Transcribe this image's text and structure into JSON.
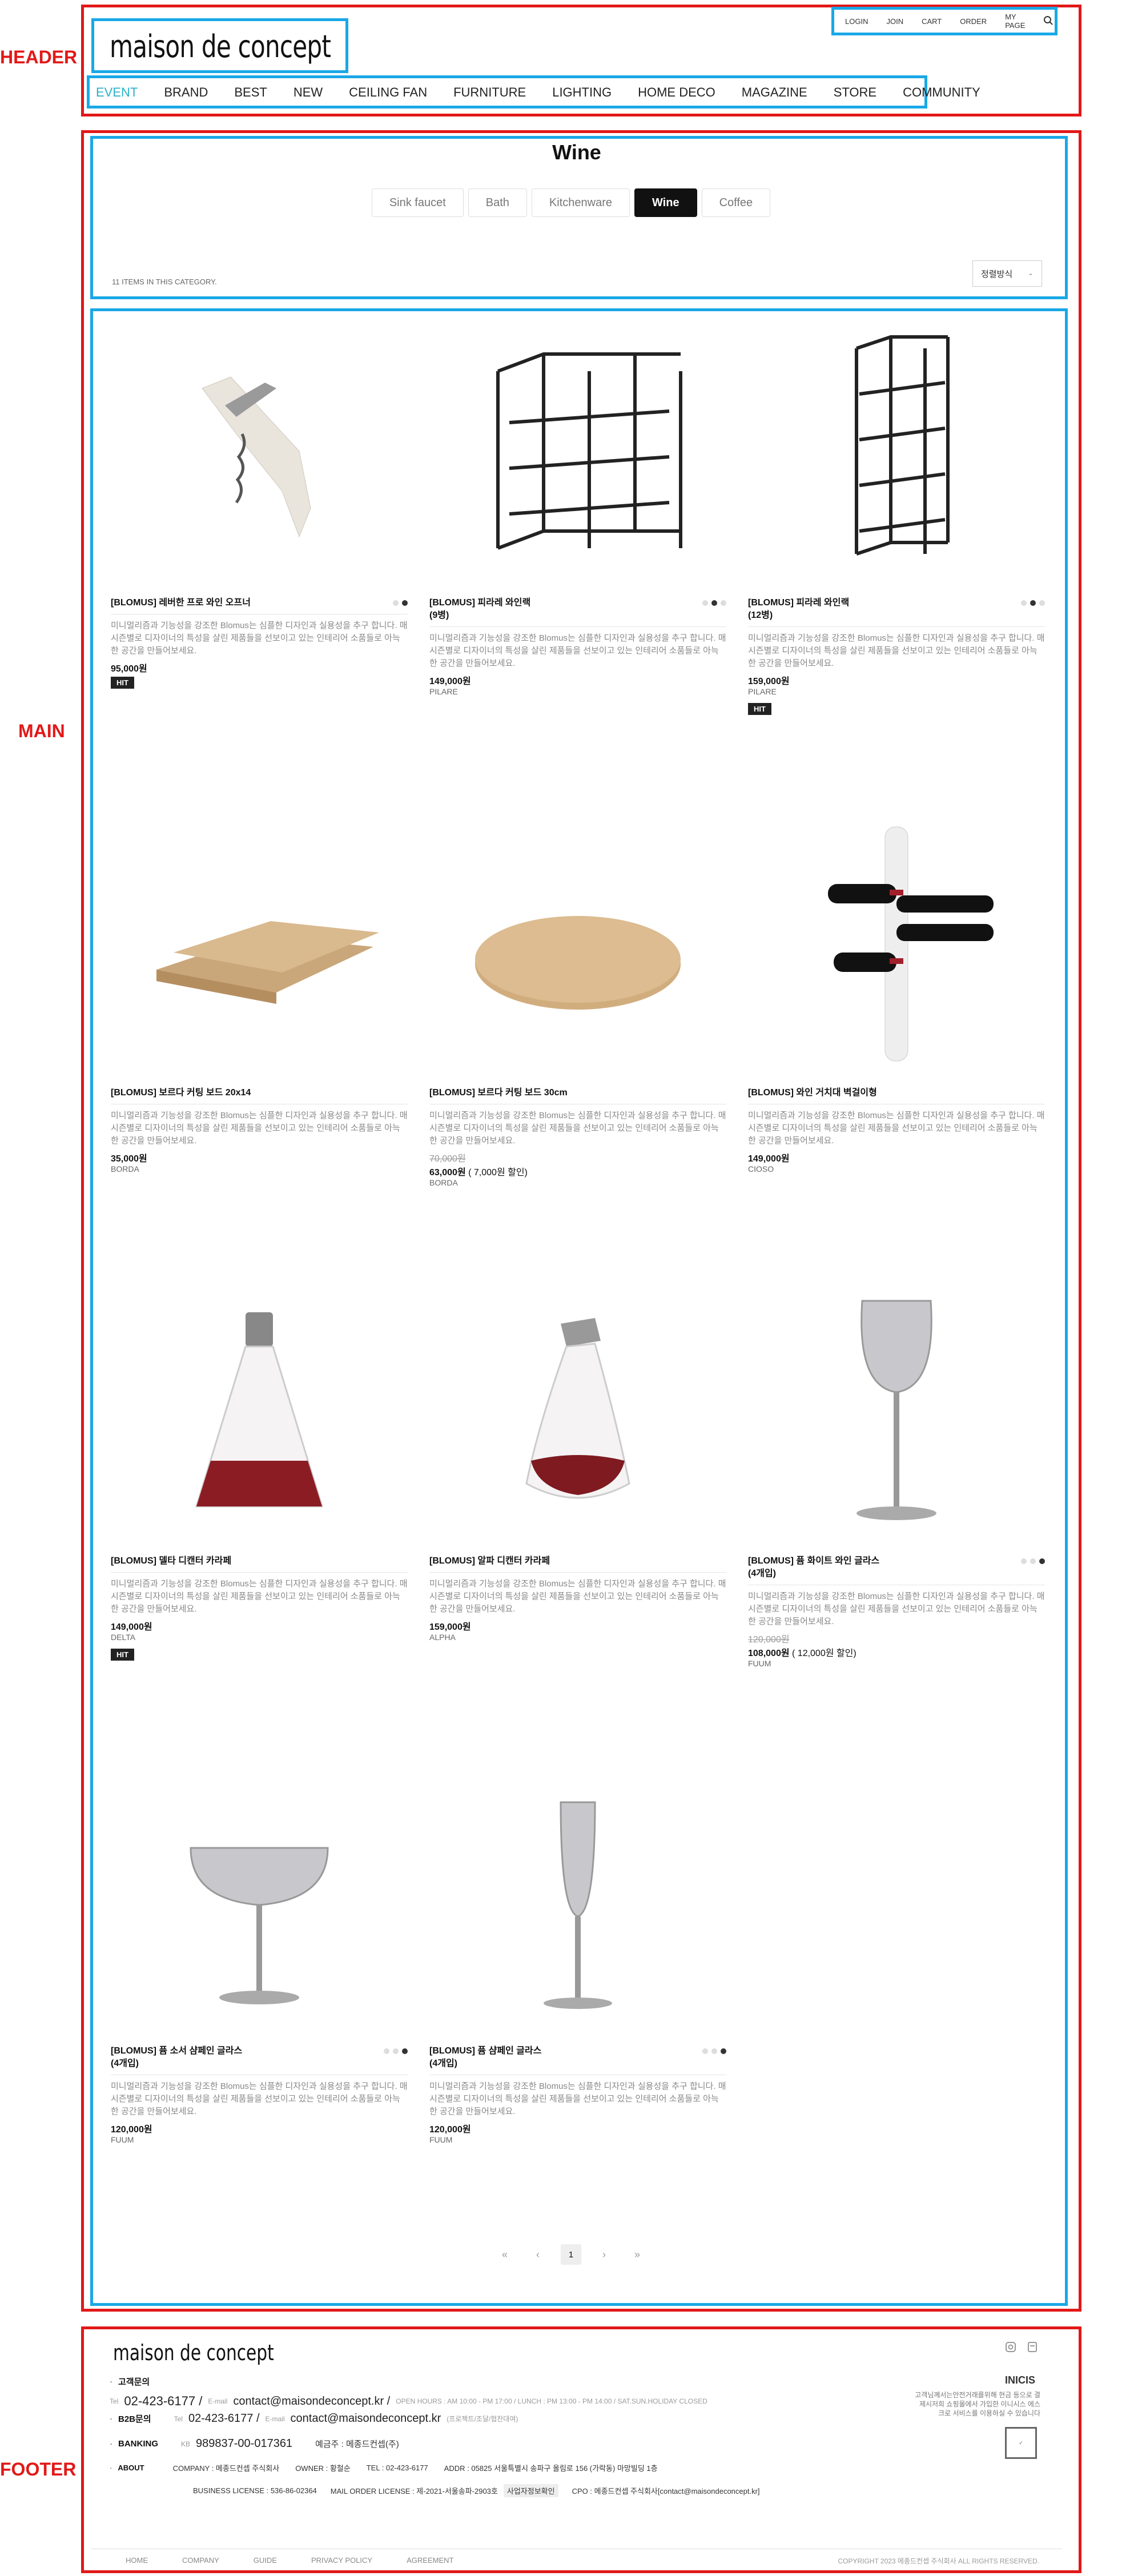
{
  "annotations": {
    "header": "HEADER",
    "main": "MAIN",
    "footer": "FOOTER"
  },
  "header": {
    "logo": "maison de concept",
    "utility": [
      "LOGIN",
      "JOIN",
      "CART",
      "ORDER",
      "MY PAGE"
    ],
    "search_icon": "search-icon",
    "nav": [
      "EVENT",
      "BRAND",
      "BEST",
      "NEW",
      "CEILING FAN",
      "FURNITURE",
      "LIGHTING",
      "HOME DECO",
      "MAGAZINE",
      "STORE",
      "COMMUNITY"
    ],
    "active_color": "#2bb0c8"
  },
  "category": {
    "title": "Wine",
    "tabs": [
      {
        "label": "Sink faucet",
        "active": false
      },
      {
        "label": "Bath",
        "active": false
      },
      {
        "label": "Kitchenware",
        "active": false
      },
      {
        "label": "Wine",
        "active": true
      },
      {
        "label": "Coffee",
        "active": false
      }
    ],
    "item_count": "11 ITEMS IN THIS CATEGORY.",
    "sort_label": "정렬방식"
  },
  "products": [
    {
      "name": "[BLOMUS] 레버한 프로 와인 오프너",
      "desc": "미니멀리즘과 기능성을 강조한 Blomus는 심플한 디자인과 실용성을 추구 합니다. 매 시즌별로 디자이너의 특성을 살린 제품들을 선보이고 있는 인테리어 소품들로 아늑한 공간을 만들어보세요.",
      "price": "95,000원",
      "old_price": "",
      "sale": "",
      "brand": "",
      "hit": "HIT",
      "dots": 2,
      "dot_on": 1
    },
    {
      "name": "[BLOMUS] 피라레 와인랙\n(9병)",
      "desc": "미니멀리즘과 기능성을 강조한 Blomus는 심플한 디자인과 실용성을 추구 합니다. 매 시즌별로 디자이너의 특성을 살린 제품들을 선보이고 있는 인테리어 소품들로 아늑한 공간을 만들어보세요.",
      "price": "149,000원",
      "old_price": "",
      "sale": "",
      "brand": "PILARE",
      "hit": "",
      "dots": 3,
      "dot_on": 1
    },
    {
      "name": "[BLOMUS] 피라레 와인랙\n(12병)",
      "desc": "미니멀리즘과 기능성을 강조한 Blomus는 심플한 디자인과 실용성을 추구 합니다. 매 시즌별로 디자이너의 특성을 살린 제품들을 선보이고 있는 인테리어 소품들로 아늑한 공간을 만들어보세요.",
      "price": "159,000원",
      "old_price": "",
      "sale": "",
      "brand": "PILARE",
      "hit": "HIT",
      "dots": 3,
      "dot_on": 1
    },
    {
      "name": "[BLOMUS] 보르다 커팅 보드 20x14",
      "desc": "미니멀리즘과 기능성을 강조한 Blomus는 심플한 디자인과 실용성을 추구 합니다. 매 시즌별로 디자이너의 특성을 살린 제품들을 선보이고 있는 인테리어 소품들로 아늑한 공간을 만들어보세요.",
      "price": "35,000원",
      "old_price": "",
      "sale": "",
      "brand": "BORDA",
      "hit": "",
      "dots": 0,
      "dot_on": -1
    },
    {
      "name": "[BLOMUS] 보르다 커팅 보드 30cm",
      "desc": "미니멀리즘과 기능성을 강조한 Blomus는 심플한 디자인과 실용성을 추구 합니다. 매 시즌별로 디자이너의 특성을 살린 제품들을 선보이고 있는 인테리어 소품들로 아늑한 공간을 만들어보세요.",
      "price": "63,000원",
      "old_price": "70,000원",
      "sale": "( 7,000원 할인)",
      "brand": "BORDA",
      "hit": "",
      "dots": 0,
      "dot_on": -1
    },
    {
      "name": "[BLOMUS] 와인 거치대 벽걸이형",
      "desc": "미니멀리즘과 기능성을 강조한 Blomus는 심플한 디자인과 실용성을 추구 합니다. 매 시즌별로 디자이너의 특성을 살린 제품들을 선보이고 있는 인테리어 소품들로 아늑한 공간을 만들어보세요.",
      "price": "149,000원",
      "old_price": "",
      "sale": "",
      "brand": "CIOSO",
      "hit": "",
      "dots": 0,
      "dot_on": -1
    },
    {
      "name": "[BLOMUS] 델타 디캔터 카라페",
      "desc": "미니멀리즘과 기능성을 강조한 Blomus는 심플한 디자인과 실용성을 추구 합니다. 매 시즌별로 디자이너의 특성을 살린 제품들을 선보이고 있는 인테리어 소품들로 아늑한 공간을 만들어보세요.",
      "price": "149,000원",
      "old_price": "",
      "sale": "",
      "brand": "DELTA",
      "hit": "HIT",
      "dots": 0,
      "dot_on": -1
    },
    {
      "name": "[BLOMUS] 알파 디캔터 카라페",
      "desc": "미니멀리즘과 기능성을 강조한 Blomus는 심플한 디자인과 실용성을 추구 합니다. 매 시즌별로 디자이너의 특성을 살린 제품들을 선보이고 있는 인테리어 소품들로 아늑한 공간을 만들어보세요.",
      "price": "159,000원",
      "old_price": "",
      "sale": "",
      "brand": "ALPHA",
      "hit": "",
      "dots": 0,
      "dot_on": -1
    },
    {
      "name": "[BLOMUS] 퓸 화이트 와인 글라스\n(4개입)",
      "desc": "미니멀리즘과 기능성을 강조한 Blomus는 심플한 디자인과 실용성을 추구 합니다. 매 시즌별로 디자이너의 특성을 살린 제품들을 선보이고 있는 인테리어 소품들로 아늑한 공간을 만들어보세요.",
      "price": "108,000원",
      "old_price": "120,000원",
      "sale": "( 12,000원 할인)",
      "brand": "FUUM",
      "hit": "",
      "dots": 3,
      "dot_on": 2
    },
    {
      "name": "[BLOMUS] 퓸 소서 샴페인 글라스\n(4개입)",
      "desc": "미니멀리즘과 기능성을 강조한 Blomus는 심플한 디자인과 실용성을 추구 합니다. 매 시즌별로 디자이너의 특성을 살린 제품들을 선보이고 있는 인테리어 소품들로 아늑한 공간을 만들어보세요.",
      "price": "120,000원",
      "old_price": "",
      "sale": "",
      "brand": "FUUM",
      "hit": "",
      "dots": 3,
      "dot_on": 2
    },
    {
      "name": "[BLOMUS] 퓸 샴페인 글라스\n(4개입)",
      "desc": "미니멀리즘과 기능성을 강조한 Blomus는 심플한 디자인과 실용성을 추구 합니다. 매 시즌별로 디자이너의 특성을 살린 제품들을 선보이고 있는 인테리어 소품들로 아늑한 공간을 만들어보세요.",
      "price": "120,000원",
      "old_price": "",
      "sale": "",
      "brand": "FUUM",
      "hit": "",
      "dots": 3,
      "dot_on": 2
    }
  ],
  "pager": {
    "first": "«",
    "prev": "‹",
    "current": "1",
    "next": "›",
    "last": "»"
  },
  "footer": {
    "logo": "maison de concept",
    "cs_label": "고객문의",
    "tel_label": "Tel",
    "tel": "02-423-6177 /",
    "email_label": "E-mail",
    "email": "contact@maisondeconcept.kr /",
    "hours": "OPEN HOURS : AM 10:00 - PM 17:00 / LUNCH : PM 13:00 - PM 14:00 / SAT.SUN.HOLIDAY CLOSED",
    "b2b_label": "B2B문의",
    "b2b_tel": "02-423-6177 /",
    "b2b_email": "contact@maisondeconcept.kr",
    "b2b_note": "(프로젝트/조달/협찬대여)",
    "bank_label": "BANKING",
    "bank_name": "KB",
    "bank_account": "989837-00-017361",
    "bank_holder": "예금주 : 메종드컨셉(주)",
    "about_label": "ABOUT",
    "company": "COMPANY : 메종드컨셉 주식회사",
    "owner": "OWNER : 황철순",
    "about_tel": "TEL : 02-423-6177",
    "addr": "ADDR : 05825 서울특별시 송파구 올림로 156 (가락동) 마망빌딩 1층",
    "biz": "BUSINESS LICENSE : 536-86-02364",
    "mail_order": "MAIL ORDER LICENSE : 제-2021-서울송파-2903호",
    "biz_check": "사업자정보확인",
    "cpo": "CPO : 메종드컨셉 주식회사[contact@maisondeconcept.kr]",
    "inicis_title": "INICIS",
    "inicis_text": "고객님께서는안전거래를위해 현금 등으로 결제시저희 쇼핑몰에서 가입한 이니시스 에스크로 서비스를 이용하실 수 있습니다",
    "links": [
      "HOME",
      "COMPANY",
      "GUIDE",
      "PRIVACY POLICY",
      "AGREEMENT"
    ],
    "copyright": "COPYRIGHT 2023 메종드컨셉 주식회사 ALL RIGHTS RESERVED."
  }
}
